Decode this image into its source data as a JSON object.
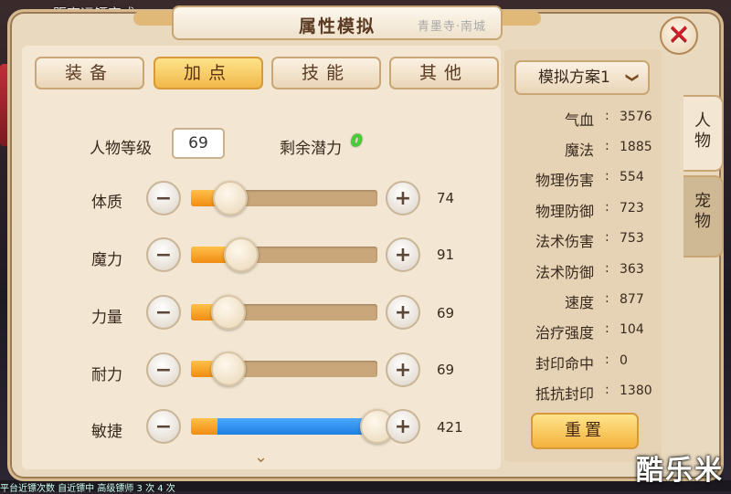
{
  "background": {
    "top_text": "距离运镖完成",
    "bottom_text": "平台近镖次数  自近镖中  高级镖师  3 次 4 次",
    "watermark": "酷乐米"
  },
  "window": {
    "title": "属性模拟",
    "title_decor_text": "青墨寺·南城",
    "close_label": "✕"
  },
  "tabs": [
    {
      "label": "装备",
      "active": false
    },
    {
      "label": "加点",
      "active": true
    },
    {
      "label": "技能",
      "active": false
    },
    {
      "label": "其他",
      "active": false
    }
  ],
  "level": {
    "label": "人物等级",
    "value": "69"
  },
  "potential": {
    "label": "剩余潜力",
    "value": "0"
  },
  "stats": [
    {
      "name": "体质",
      "value": "74",
      "base_fraction": 0.15,
      "added_fraction": 0.0
    },
    {
      "name": "魔力",
      "value": "91",
      "base_fraction": 0.21,
      "added_fraction": 0.0
    },
    {
      "name": "力量",
      "value": "69",
      "base_fraction": 0.14,
      "added_fraction": 0.0
    },
    {
      "name": "耐力",
      "value": "69",
      "base_fraction": 0.14,
      "added_fraction": 0.0
    },
    {
      "name": "敏捷",
      "value": "421",
      "base_fraction": 0.14,
      "added_fraction": 0.84
    }
  ],
  "plan": {
    "label": "模拟方案1"
  },
  "attributes": [
    {
      "name": "气血",
      "value": "3576"
    },
    {
      "name": "魔法",
      "value": "1885"
    },
    {
      "name": "物理伤害",
      "value": "554"
    },
    {
      "name": "物理防御",
      "value": "723"
    },
    {
      "name": "法术伤害",
      "value": "753"
    },
    {
      "name": "法术防御",
      "value": "363"
    },
    {
      "name": "速度",
      "value": "877"
    },
    {
      "name": "治疗强度",
      "value": "104"
    },
    {
      "name": "封印命中",
      "value": "0"
    },
    {
      "name": "抵抗封印",
      "value": "1380"
    }
  ],
  "reset_label": "重置",
  "side_tabs": [
    {
      "label": "人物",
      "active": true
    },
    {
      "label": "宠物",
      "active": false
    }
  ],
  "colors": {
    "panel": "#e9d9bf",
    "active_tab": "#f2b84a",
    "base_fill": "#f08c12",
    "added_fill": "#1f7fe0",
    "potential": "#3fd62f",
    "close": "#d0202a"
  },
  "icons": {
    "minus": "−",
    "plus": "+",
    "dropdown": "❯",
    "more": "⌄"
  }
}
